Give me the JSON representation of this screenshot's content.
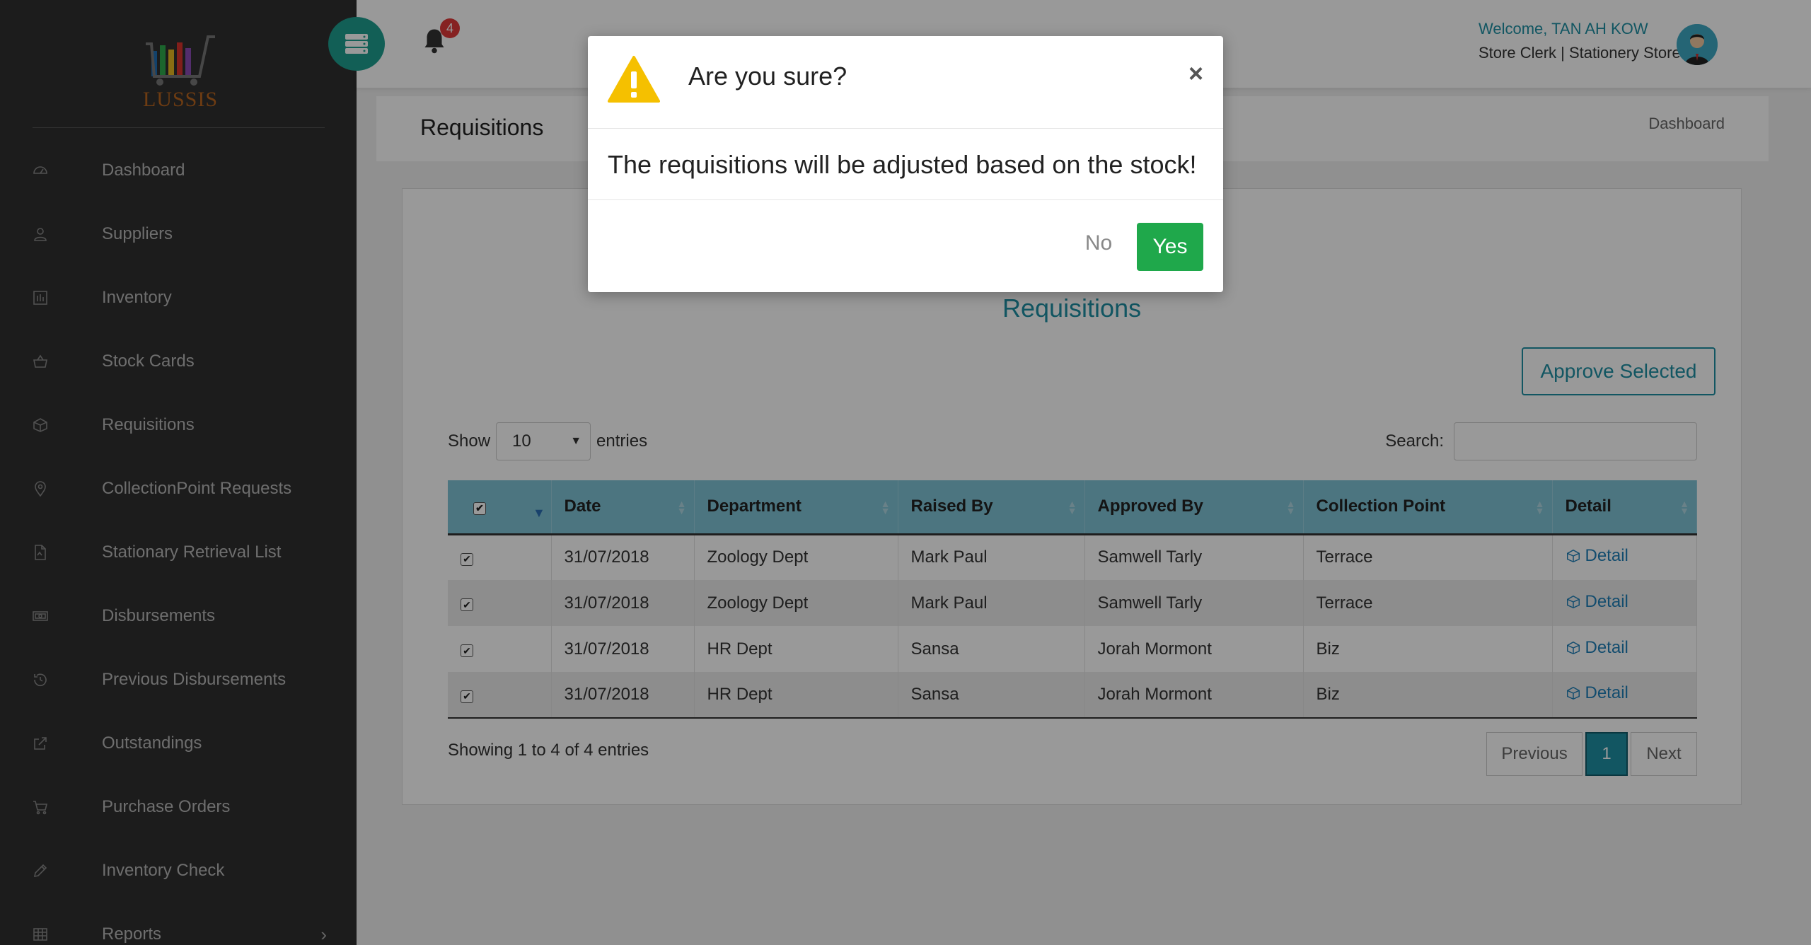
{
  "app": {
    "logo_text": "LUSSIS"
  },
  "sidebar": {
    "items": [
      {
        "label": "Dashboard",
        "icon": "dashboard-icon"
      },
      {
        "label": "Suppliers",
        "icon": "user-icon"
      },
      {
        "label": "Inventory",
        "icon": "inventory-icon"
      },
      {
        "label": "Stock Cards",
        "icon": "basket-icon"
      },
      {
        "label": "Requisitions",
        "icon": "box-icon"
      },
      {
        "label": "CollectionPoint Requests",
        "icon": "map-pin-icon"
      },
      {
        "label": "Stationary Retrieval List",
        "icon": "file-icon"
      },
      {
        "label": "Disbursements",
        "icon": "money-icon"
      },
      {
        "label": "Previous Disbursements",
        "icon": "history-icon"
      },
      {
        "label": "Outstandings",
        "icon": "external-link-icon"
      },
      {
        "label": "Purchase Orders",
        "icon": "cart-icon"
      },
      {
        "label": "Inventory Check",
        "icon": "pencil-icon"
      },
      {
        "label": "Reports",
        "icon": "table-icon"
      }
    ]
  },
  "topbar": {
    "notification_count": "4",
    "welcome": "Welcome, TAN AH KOW",
    "role": "Store Clerk | Stationery Store"
  },
  "page": {
    "title": "Requisitions",
    "breadcrumb": "Dashboard"
  },
  "main": {
    "section_title": "Requisitions",
    "approve_button": "Approve Selected",
    "show_label": "Show",
    "entries_select": "10",
    "entries_label": "entries",
    "search_label": "Search:",
    "table": {
      "headers": [
        "Date",
        "Department",
        "Raised By",
        "Approved By",
        "Collection Point",
        "Detail"
      ],
      "rows": [
        {
          "date": "31/07/2018",
          "department": "Zoology Dept",
          "raised_by": "Mark Paul",
          "approved_by": "Samwell Tarly",
          "collection_point": "Terrace",
          "detail": "Detail"
        },
        {
          "date": "31/07/2018",
          "department": "Zoology Dept",
          "raised_by": "Mark Paul",
          "approved_by": "Samwell Tarly",
          "collection_point": "Terrace",
          "detail": "Detail"
        },
        {
          "date": "31/07/2018",
          "department": "HR Dept",
          "raised_by": "Sansa",
          "approved_by": "Jorah Mormont",
          "collection_point": "Biz",
          "detail": "Detail"
        },
        {
          "date": "31/07/2018",
          "department": "HR Dept",
          "raised_by": "Sansa",
          "approved_by": "Jorah Mormont",
          "collection_point": "Biz",
          "detail": "Detail"
        }
      ]
    },
    "showing_text": "Showing 1 to 4 of 4 entries",
    "pagination": {
      "previous": "Previous",
      "current": "1",
      "next": "Next"
    }
  },
  "modal": {
    "title": "Are you sure?",
    "close": "×",
    "message": "The requisitions will be adjusted based on the stock!",
    "no_label": "No",
    "yes_label": "Yes"
  },
  "colors": {
    "sidebar_bg": "#2f2f2f",
    "accent": "#1f8fa3",
    "table_header": "#7fc3d6",
    "yes_button": "#1fa84b",
    "warning": "#f5c000",
    "badge": "#e03a3a"
  }
}
